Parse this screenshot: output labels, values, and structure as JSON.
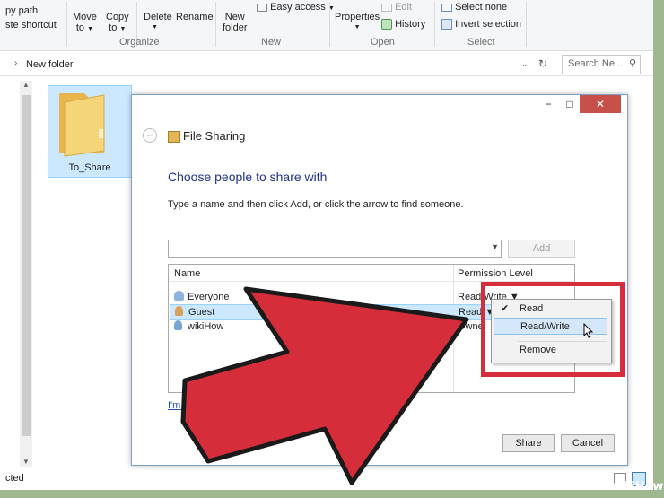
{
  "ribbon": {
    "copy_path": "py path",
    "paste_shortcut": "ste shortcut",
    "move_to": "Move",
    "move_to_sub": "to",
    "copy_to": "Copy",
    "copy_to_sub": "to",
    "delete": "Delete",
    "rename": "Rename",
    "new_folder": "New",
    "new_folder_sub": "folder",
    "easy_access": "Easy access",
    "properties": "Properties",
    "edit": "Edit",
    "history": "History",
    "select_none": "Select none",
    "invert_selection": "Invert selection",
    "groups": {
      "organize": "Organize",
      "new": "New",
      "open": "Open",
      "select": "Select"
    }
  },
  "address": {
    "path": "New folder",
    "search_placeholder": "Search Ne..."
  },
  "folder": {
    "name": "To_Share"
  },
  "status": {
    "text": "cted"
  },
  "dialog": {
    "title": "File Sharing",
    "heading": "Choose people to share with",
    "instruction": "Type a name and then click Add, or click the arrow to find someone.",
    "add_label": "Add",
    "columns": {
      "name": "Name",
      "permission": "Permission Level"
    },
    "rows": [
      {
        "name": "Everyone",
        "permission": "Read/Write ▼",
        "icon": "users-icon"
      },
      {
        "name": "Guest",
        "permission": "Read ▼",
        "icon": "user-icon"
      },
      {
        "name": "wikiHow",
        "permission": "Owne",
        "icon": "user-icon"
      }
    ],
    "help_link": "I'm having trouble sharing",
    "share_label": "Share",
    "cancel_label": "Cancel",
    "window_buttons": {
      "minimize": "−",
      "maximize": "□",
      "close": "✕"
    }
  },
  "menu": {
    "items": [
      {
        "label": "Read",
        "checked": true
      },
      {
        "label": "Read/Write",
        "highlighted": true
      },
      {
        "label": "Remove"
      }
    ],
    "check": "✔"
  },
  "watermark": "wikiHow",
  "colors": {
    "accent": "#1e3287",
    "highlight_box": "#d62d3a",
    "arrow": "#d62d3a"
  }
}
